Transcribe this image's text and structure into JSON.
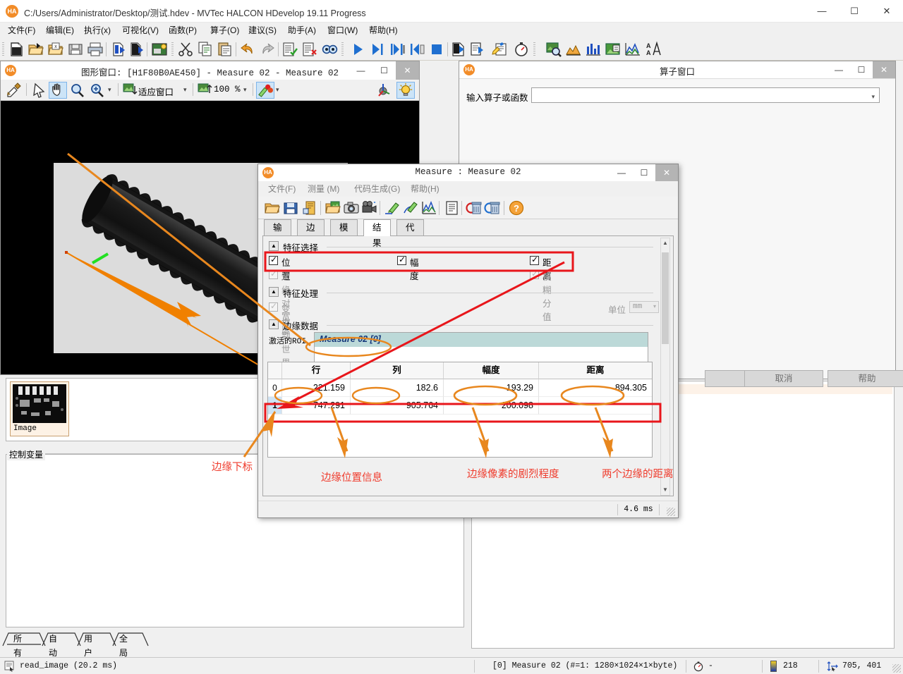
{
  "window": {
    "title": "C:/Users/Administrator/Desktop/测试.hdev - MVTec HALCON HDevelop 19.11 Progress",
    "logo": "HA",
    "minimize": "—",
    "maximize": "☐",
    "close": "✕"
  },
  "menubar": {
    "items": [
      {
        "label": "文件(F)",
        "name": "menu-file"
      },
      {
        "label": "编辑(E)",
        "name": "menu-edit"
      },
      {
        "label": "执行(x)",
        "name": "menu-execute"
      },
      {
        "label": "可视化(V)",
        "name": "menu-visualization"
      },
      {
        "label": "函数(P)",
        "name": "menu-procedures"
      },
      {
        "label": "算子(O)",
        "name": "menu-operators"
      },
      {
        "label": "建议(S)",
        "name": "menu-suggestions"
      },
      {
        "label": "助手(A)",
        "name": "menu-assistants"
      },
      {
        "label": "窗口(W)",
        "name": "menu-window"
      },
      {
        "label": "帮助(H)",
        "name": "menu-help"
      }
    ]
  },
  "toolbar": {
    "icons": [
      "new-program-icon",
      "open-program-icon",
      "open-recent-icon",
      "save-icon",
      "print-icon",
      "import-icon",
      "export-icon",
      "edit-window-icon",
      "cut-icon",
      "copy-icon",
      "paste-icon",
      "undo-icon",
      "redo-icon",
      "comment-icon",
      "uncomment-icon",
      "find-icon",
      "run-icon",
      "step-over-icon",
      "step-into-icon",
      "step-out-icon",
      "stop-icon",
      "insert-operator-icon",
      "insert-procedure-icon",
      "stopwatch-icon",
      "image-inspect-icon",
      "gray-histogram-icon",
      "histogram-icon",
      "image-variable-icon",
      "feature-plot-icon",
      "font-icon"
    ]
  },
  "graphics_window": {
    "logo": "HA",
    "title": "图形窗口: [H1F80B0AE450] - Measure 02 - Measure 02",
    "minimize": "—",
    "maximize": "☐",
    "close": "✕",
    "toolbar": {
      "edit_roi_label": "edit-roi-icon",
      "select_label": "arrow-select-icon",
      "pan_label": "pan-hand-icon",
      "zoom_label": "magnifier-icon",
      "zoom_in_label": "magnifier-plus-icon",
      "fit_mode": "适应窗口",
      "zoom_level": "100 %",
      "color_label": "paint-color-icon",
      "axes_label": "3d-axes-icon",
      "lamp_label": "lightbulb-icon",
      "dropdown_arrow": "▾"
    }
  },
  "variables_panel": {
    "thumbnail_label": "Image",
    "control_legend": "控制变量",
    "tabs": [
      {
        "label": "所有",
        "name": "var-tab-all"
      },
      {
        "label": "自动",
        "name": "var-tab-auto"
      },
      {
        "label": "用户",
        "name": "var-tab-user"
      },
      {
        "label": "全局",
        "name": "var-tab-global"
      }
    ]
  },
  "operator_window": {
    "logo": "HA",
    "title": "算子窗口",
    "minimize": "—",
    "maximize": "☐",
    "close": "✕",
    "input_label": "输入算子或函数",
    "input_value": "",
    "input_placeholder": "",
    "buttons": [
      {
        "label": "",
        "name": "op-ok-button"
      },
      {
        "label": "取消",
        "name": "op-cancel-button"
      },
      {
        "label": "帮助",
        "name": "op-help-button"
      }
    ]
  },
  "code_editor": {
    "line": ". )"
  },
  "measure_dialog": {
    "logo": "HA",
    "title": "Measure : Measure 02",
    "minimize": "—",
    "maximize": "☐",
    "close": "✕",
    "menu": [
      {
        "label": "文件(F)",
        "name": "measure-menu-file"
      },
      {
        "label": "测量 (M)",
        "name": "measure-menu-measure"
      },
      {
        "label": "代码生成(G)",
        "name": "measure-menu-codegen"
      },
      {
        "label": "帮助(H)",
        "name": "measure-menu-help"
      }
    ],
    "toolbar_icons": [
      "open-folder-icon",
      "save-icon",
      "export-icon",
      "open-image-icon",
      "camera-icon",
      "live-camera-icon",
      "draw-line-icon",
      "draw-arc-icon",
      "profile-plot-icon",
      "list-icon",
      "delete-roi-red-icon",
      "delete-roi-blue-icon",
      "help-icon"
    ],
    "tabs": [
      {
        "label": "输入",
        "name": "measure-tab-input",
        "active": false
      },
      {
        "label": "边缘",
        "name": "measure-tab-edges",
        "active": false
      },
      {
        "label": "模糊",
        "name": "measure-tab-fuzzy",
        "active": false
      },
      {
        "label": "结果",
        "name": "measure-tab-results",
        "active": true
      },
      {
        "label": "代码生成",
        "name": "measure-tab-codegen",
        "active": false
      }
    ],
    "feature_selection": {
      "group_title": "特征选择",
      "checkboxes": [
        {
          "label": "位置",
          "checked": true,
          "enabled": true,
          "name": "checkbox-position"
        },
        {
          "label": "幅度",
          "checked": true,
          "enabled": true,
          "name": "checkbox-amplitude"
        },
        {
          "label": "距离",
          "checked": true,
          "enabled": true,
          "name": "checkbox-distance"
        },
        {
          "label": "边缘对宽度",
          "checked": true,
          "enabled": false,
          "name": "checkbox-edge-pair-width"
        },
        {
          "label": "模糊分值",
          "checked": true,
          "enabled": false,
          "name": "checkbox-fuzzy-score"
        }
      ]
    },
    "feature_processing": {
      "group_title": "特征处理",
      "world_coords_label": "变换到世界坐标系",
      "world_coords_checked": true,
      "world_coords_enabled": false,
      "unit_label": "单位",
      "unit_value": "mm"
    },
    "edge_data": {
      "group_title": "边缘数据",
      "active_roi_label": "激活的ROI",
      "active_roi_value": "Measure 02 [0]"
    },
    "results_table": {
      "columns": [
        "",
        "行",
        "列",
        "幅度",
        "距离"
      ],
      "rows": [
        {
          "index": "0",
          "row": "221.159",
          "col": "182.6",
          "amplitude": "-193.29",
          "distance": "894.305"
        },
        {
          "index": "1",
          "row": "747.291",
          "col": "905.764",
          "amplitude": "200.098",
          "distance": ""
        }
      ]
    },
    "status_time": "4.6 ms"
  },
  "annotations": [
    {
      "text": "边缘下标",
      "name": "annotation-edge-index"
    },
    {
      "text": "边缘位置信息",
      "name": "annotation-edge-position"
    },
    {
      "text": "边缘像素的剧烈程度",
      "name": "annotation-edge-amplitude"
    },
    {
      "text": "两个边缘的距离",
      "name": "annotation-edge-distance"
    }
  ],
  "status_bar": {
    "icon": "program-counter-icon",
    "message": "read_image (20.2 ms)",
    "image_info": "[0] Measure 02 (#=1: 1280×1024×1×byte)",
    "timer_icon": "stopwatch-icon",
    "timer_value": "-",
    "gray_icon": "gray-ramp-icon",
    "gray_value": "218",
    "coord_icon": "cursor-coords-icon",
    "coord_value": "705, 401"
  },
  "colors": {
    "accent_orange": "#f28c28",
    "annotation_red": "#ef3b2c",
    "highlight_box_red": "#e8161b",
    "roi_selection": "#bcd9d8",
    "selected_tool": "#cce4f7"
  }
}
